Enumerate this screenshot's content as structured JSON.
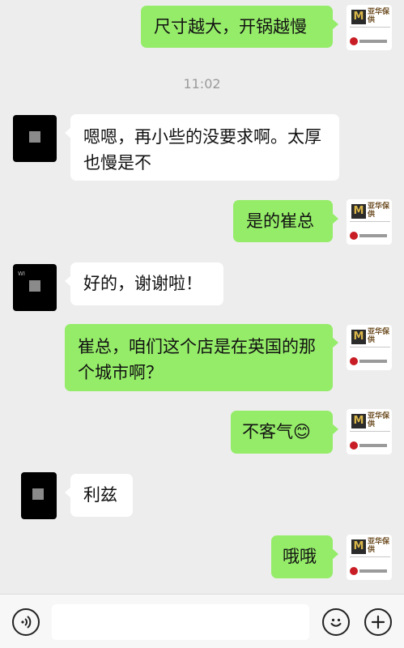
{
  "time_label": "11:02",
  "messages": [
    {
      "side": "me",
      "text": "尺寸越大，开锅越慢"
    },
    {
      "side": "them",
      "text": "嗯嗯，再小些的没要求啊。太厚也慢是不"
    },
    {
      "side": "me",
      "text": "是的崔总"
    },
    {
      "side": "them",
      "text": "好的，谢谢啦！"
    },
    {
      "side": "me",
      "text": "崔总，咱们这个店是在英国的那个城市啊？"
    },
    {
      "side": "me",
      "text": "不客气😊"
    },
    {
      "side": "them",
      "text": "利兹"
    },
    {
      "side": "me",
      "text": "哦哦"
    }
  ],
  "avatar_me": {
    "logo_letter": "M",
    "brand_text": "亚华保供"
  },
  "avatar_them": {
    "watermark": "WI"
  },
  "input_bar": {
    "voice_icon": "voice-icon",
    "emoji_icon": "emoji-icon",
    "plus_icon": "plus-icon",
    "text_value": ""
  }
}
